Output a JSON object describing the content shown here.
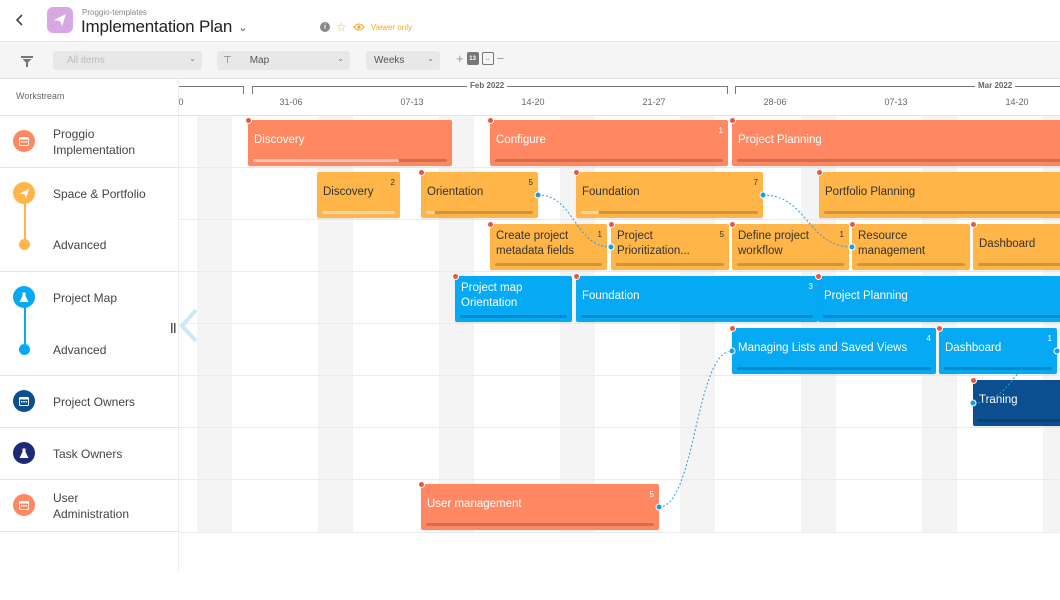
{
  "header": {
    "breadcrumb": "Proggio-templates",
    "title": "Implementation Plan",
    "access_label": "Viewer only",
    "icons": [
      "back-arrow-icon",
      "paper-plane-icon",
      "chevron-down-icon",
      "info-icon",
      "star-icon",
      "eye-icon"
    ]
  },
  "toolbar": {
    "filter_select": "All items",
    "view_select": "Map",
    "scale_select": "Weeks",
    "zoom_in": "+",
    "zoom_out": "−",
    "today_label": "13"
  },
  "workstream_header": "Workstream",
  "colors": {
    "salmon": "#ff8863",
    "amber": "#ffb547",
    "blue": "#05a9f4",
    "navy": "#0b4f91",
    "indigo": "#1e2a78"
  },
  "workstreams": [
    {
      "label": "Proggio Implementation",
      "icon": "calendar-icon",
      "color": "#ff8863"
    },
    {
      "label": "Space & Portfolio",
      "icon": "paper-plane-icon",
      "color": "#ffb547",
      "sub": "Advanced"
    },
    {
      "label": "Project Map",
      "icon": "flask-icon",
      "color": "#05a9f4",
      "sub": "Advanced"
    },
    {
      "label": "Project Owners",
      "icon": "calendar-icon",
      "color": "#0b4f91"
    },
    {
      "label": "Task Owners",
      "icon": "flask-icon",
      "color": "#1e2a78"
    },
    {
      "label": "User Administration",
      "icon": "calendar-icon",
      "color": "#ff8863"
    }
  ],
  "timeline": {
    "months": [
      {
        "label": "Feb 2022"
      },
      {
        "label": "Mar 2022"
      }
    ],
    "weeks": [
      "0",
      "31-06",
      "07-13",
      "14-20",
      "21-27",
      "28-06",
      "07-13",
      "14-20"
    ]
  },
  "activities": [
    {
      "name": "Discovery",
      "row": 0,
      "color": "salmon",
      "count": "",
      "progress": 0.75
    },
    {
      "name": "Configure",
      "row": 0,
      "color": "salmon",
      "count": "1",
      "progress": 0
    },
    {
      "name": "Project Planning",
      "row": 0,
      "color": "salmon",
      "count": "",
      "progress": 0
    },
    {
      "name": "Discovery",
      "row": 1,
      "color": "amber",
      "count": "2",
      "progress": 1.0
    },
    {
      "name": "Orientation",
      "row": 1,
      "color": "amber",
      "count": "5",
      "progress": 0.08
    },
    {
      "name": "Foundation",
      "row": 1,
      "color": "amber",
      "count": "7",
      "progress": 0.1
    },
    {
      "name": "Portfolio Planning",
      "row": 1,
      "color": "amber",
      "count": "",
      "progress": 0
    },
    {
      "name": "Create project metadata fields",
      "row": 2,
      "color": "amber",
      "count": "1",
      "progress": 0
    },
    {
      "name": "Project Prioritization...",
      "row": 2,
      "color": "amber",
      "count": "5",
      "progress": 0
    },
    {
      "name": "Define project workflow",
      "row": 2,
      "color": "amber",
      "count": "1",
      "progress": 0
    },
    {
      "name": "Resource management",
      "row": 2,
      "color": "amber",
      "count": "",
      "progress": 0
    },
    {
      "name": "Dashboard",
      "row": 2,
      "color": "amber",
      "count": "",
      "progress": 0
    },
    {
      "name": "Project map Orientation",
      "row": 3,
      "color": "blue",
      "count": "",
      "progress": 0
    },
    {
      "name": "Foundation",
      "row": 3,
      "color": "blue",
      "count": "3",
      "progress": 0
    },
    {
      "name": "Project Planning",
      "row": 3,
      "color": "blue",
      "count": "",
      "progress": 0
    },
    {
      "name": "Managing Lists and Saved Views",
      "row": 4,
      "color": "blue",
      "count": "4",
      "progress": 0
    },
    {
      "name": "Dashboard",
      "row": 4,
      "color": "blue",
      "count": "1",
      "progress": 0
    },
    {
      "name": "Traning",
      "row": 5,
      "color": "navy",
      "count": "",
      "progress": 0
    },
    {
      "name": "User management",
      "row": 7,
      "color": "salmon",
      "count": "5",
      "progress": 0
    }
  ],
  "dependencies": [
    {
      "from": "Orientation",
      "to": "Project Prioritization..."
    },
    {
      "from": "Foundation",
      "to": "Resource management"
    },
    {
      "from": "User management",
      "to": "Managing Lists and Saved Views"
    },
    {
      "from": "Dashboard",
      "to": "Traning"
    }
  ]
}
